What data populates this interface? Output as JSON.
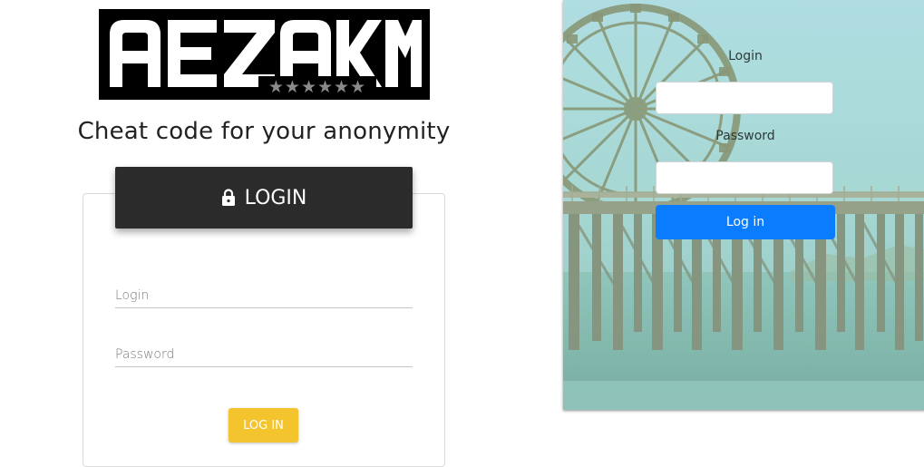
{
  "logo": {
    "text": "AEZAKMI",
    "stars": "★★★★★★"
  },
  "tagline": "Cheat code for your anonymity",
  "login_card": {
    "header": "LOGIN",
    "header_icon": "lock-icon",
    "login_placeholder": "Login",
    "password_placeholder": "Password",
    "submit_label": "LOG IN"
  },
  "right_form": {
    "login_label": "Login",
    "password_label": "Password",
    "submit_label": "Log in"
  },
  "colors": {
    "header_bg": "#2b2b2b",
    "yellow_button": "#f4c42f",
    "blue_button": "#0a7cff"
  }
}
